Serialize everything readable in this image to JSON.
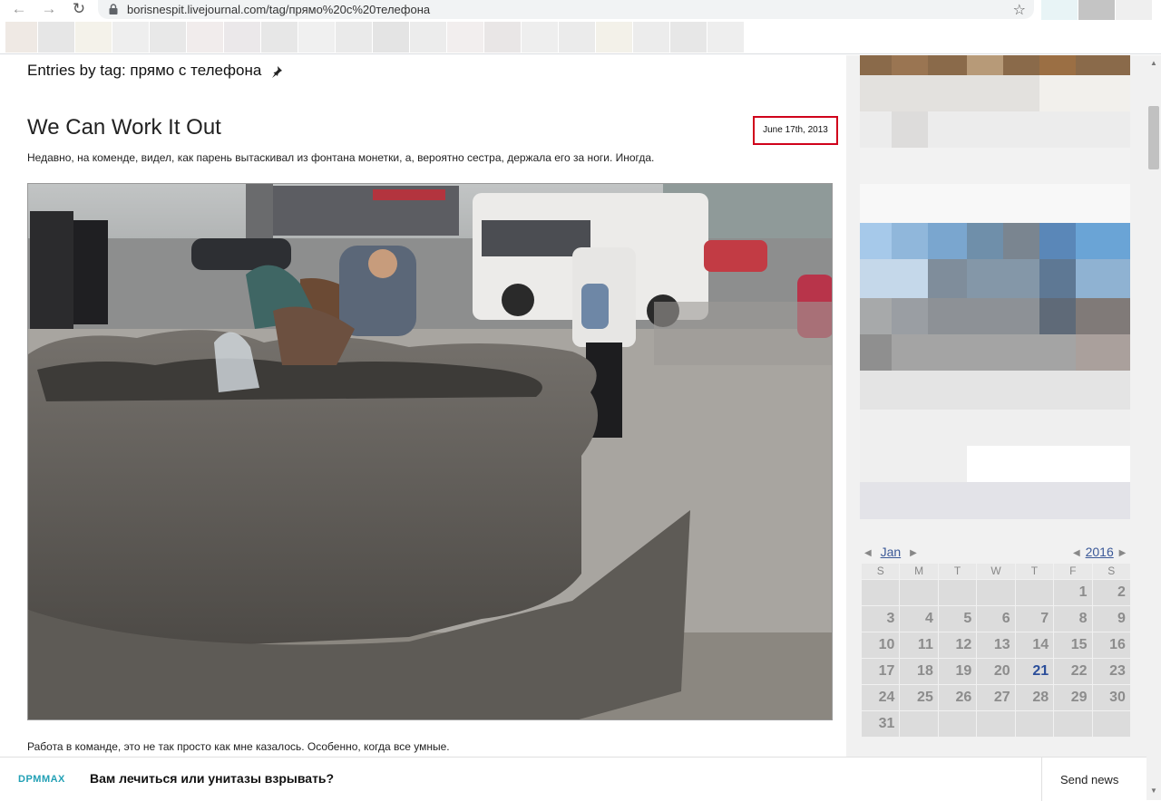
{
  "browser": {
    "url": "borisnespit.livejournal.com/tag/прямо%20c%20телефона"
  },
  "page": {
    "tag_heading": "Entries by tag: прямо с телефона"
  },
  "entry": {
    "title": "We Can Work It Out",
    "date": "June 17th, 2013",
    "text": "Недавно, на коменде, видел, как парень вытаскивал из фонтана монетки, а, вероятно сестра, держала его за ноги. Иногда.",
    "text2": "Работа в команде, это не так просто как мне казалось. Особенно, когда все умные."
  },
  "calendar": {
    "month": "Jan",
    "year": "2016",
    "weekdays": [
      "S",
      "M",
      "T",
      "W",
      "T",
      "F",
      "S"
    ],
    "rows": [
      [
        "",
        "",
        "",
        "",
        "",
        "1",
        "2"
      ],
      [
        "3",
        "4",
        "5",
        "6",
        "7",
        "8",
        "9"
      ],
      [
        "10",
        "11",
        "12",
        "13",
        "14",
        "15",
        "16"
      ],
      [
        "17",
        "18",
        "19",
        "20",
        "21",
        "22",
        "23"
      ],
      [
        "24",
        "25",
        "26",
        "27",
        "28",
        "29",
        "30"
      ],
      [
        "31",
        "",
        "",
        "",
        "",
        "",
        ""
      ]
    ],
    "highlighted_day": "21"
  },
  "newsbar": {
    "brand": "DPMMAX",
    "headline": "Вам лечиться или унитазы взрывать?",
    "send_label": "Send news"
  }
}
